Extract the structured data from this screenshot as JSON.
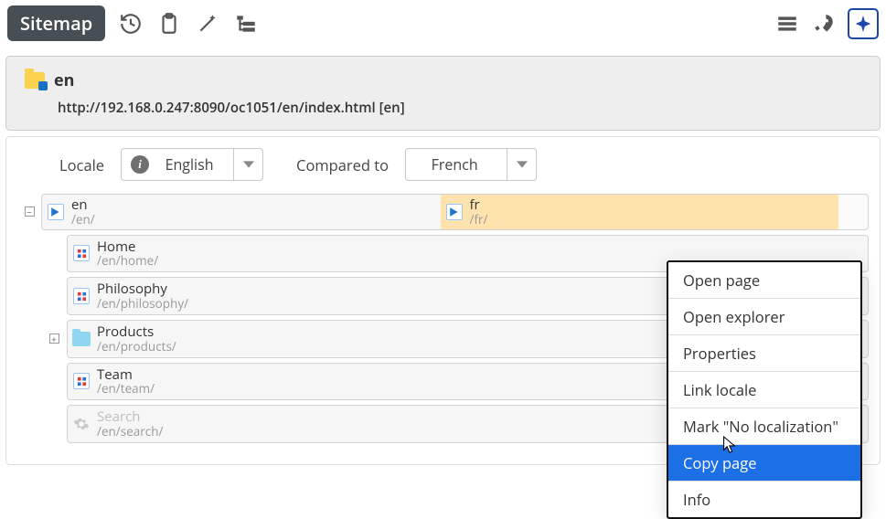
{
  "toolbar": {
    "title": "Sitemap"
  },
  "header": {
    "title": "en",
    "url": "http://192.168.0.247:8090/oc1051/en/index.html [en]"
  },
  "locale": {
    "label": "Locale",
    "value": "English",
    "compared_label": "Compared to",
    "compared_value": "French"
  },
  "tree": {
    "root_left": {
      "title": "en",
      "path": "/en/"
    },
    "root_right": {
      "title": "fr",
      "path": "/fr/"
    },
    "items": [
      {
        "title": "Home",
        "path": "/en/home/"
      },
      {
        "title": "Philosophy",
        "path": "/en/philosophy/"
      },
      {
        "title": "Products",
        "path": "/en/products/"
      },
      {
        "title": "Team",
        "path": "/en/team/"
      },
      {
        "title": "Search",
        "path": "/en/search/"
      }
    ]
  },
  "context_menu": {
    "items": [
      "Open page",
      "Open explorer",
      "Properties",
      "Link locale",
      "Mark \"No localization\"",
      "Copy page",
      "Info"
    ],
    "selected_index": 5
  }
}
